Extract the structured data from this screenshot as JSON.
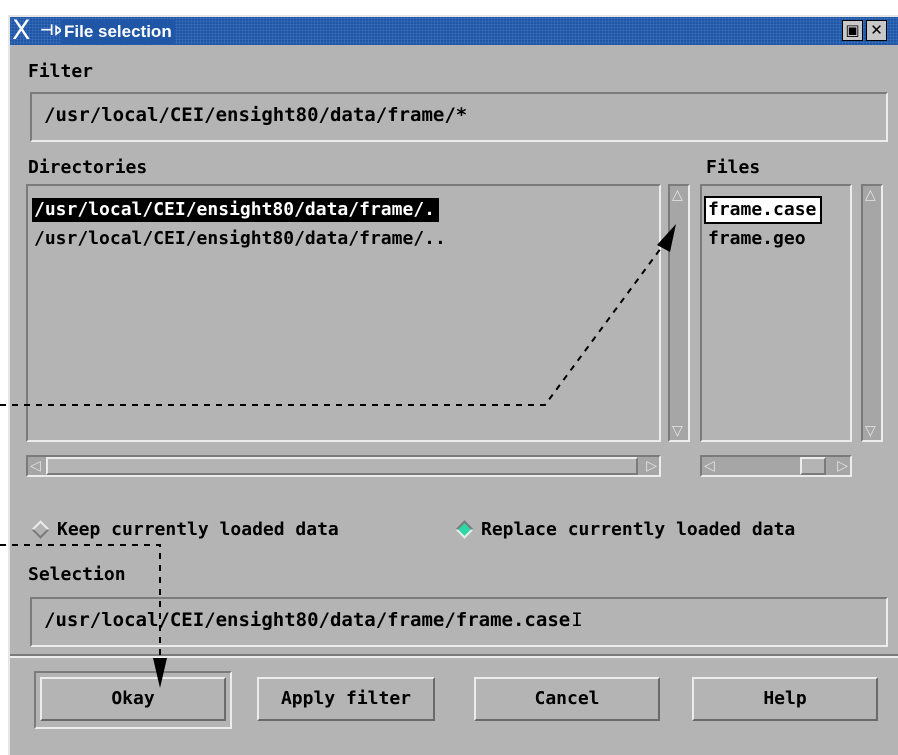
{
  "window": {
    "title": "File selection",
    "menu_glyph": "X",
    "pin_glyph": "⊣⋈",
    "maximize_icon": "▣",
    "close_icon": "✕"
  },
  "filter": {
    "label": "Filter",
    "value": "/usr/local/CEI/ensight80/data/frame/*"
  },
  "directories": {
    "label": "Directories",
    "items": [
      {
        "text": "/usr/local/CEI/ensight80/data/frame/.",
        "selected": true
      },
      {
        "text": "/usr/local/CEI/ensight80/data/frame/..",
        "selected": false
      }
    ]
  },
  "files": {
    "label": "Files",
    "items": [
      {
        "text": "frame.case",
        "selected": true
      },
      {
        "text": "frame.geo",
        "selected": false
      }
    ]
  },
  "scroll_arrows": {
    "up": "△",
    "down": "▽",
    "left": "◁",
    "right": "▷"
  },
  "load_mode": {
    "options": [
      {
        "label": "Keep currently loaded data",
        "checked": false
      },
      {
        "label": "Replace currently loaded data",
        "checked": true
      }
    ],
    "checked_color": "#2fd6a7"
  },
  "selection": {
    "label": "Selection",
    "value": "/usr/local/CEI/ensight80/data/frame/frame.case",
    "cursor": "I"
  },
  "buttons": {
    "okay": "Okay",
    "apply_filter": "Apply filter",
    "cancel": "Cancel",
    "help": "Help"
  },
  "colors": {
    "titlebar": "#1f56a6",
    "panel": "#b4b4b4"
  }
}
